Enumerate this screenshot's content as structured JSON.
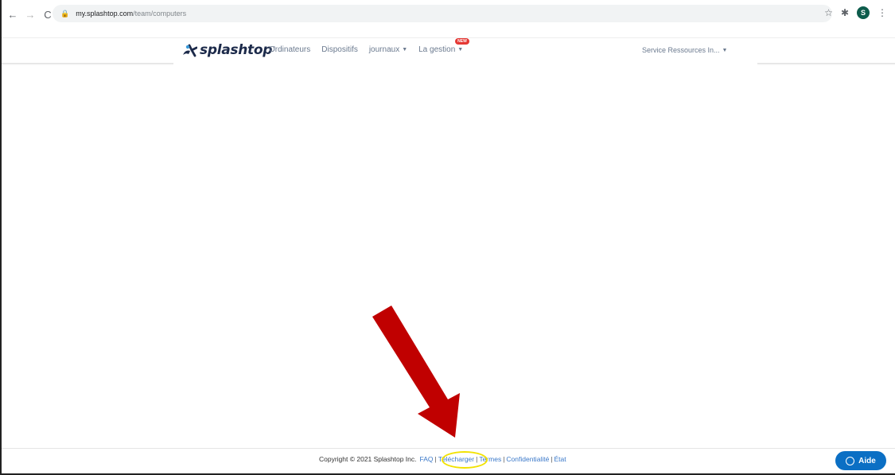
{
  "browser": {
    "url_host": "my.splashtop.com",
    "url_path": "/team/computers",
    "profile_initial": "S",
    "icons": [
      "back-icon",
      "forward-icon",
      "reload-icon",
      "lock-icon",
      "star-icon",
      "extensions-icon",
      "menu-icon"
    ]
  },
  "header": {
    "brand": "splashtop",
    "nav": [
      {
        "label": "Ordinateurs"
      },
      {
        "label": "Dispositifs"
      },
      {
        "label": "journaux"
      },
      {
        "label": "La gestion",
        "badge": "NEW"
      }
    ],
    "team_selector": "Service Ressources In..."
  },
  "footer": {
    "copyright": "Copyright © 2021 Splashtop Inc.",
    "links": [
      "FAQ",
      "Télécharger",
      "Termes",
      "Confidentialité",
      "État"
    ],
    "help_label": "Aide"
  },
  "colors": {
    "accent": "#0b6fc4",
    "link": "#3a78c9",
    "annotation_arrow": "#c00000",
    "annotation_ring": "#f2e200",
    "brand_dark": "#1c2a4a"
  }
}
